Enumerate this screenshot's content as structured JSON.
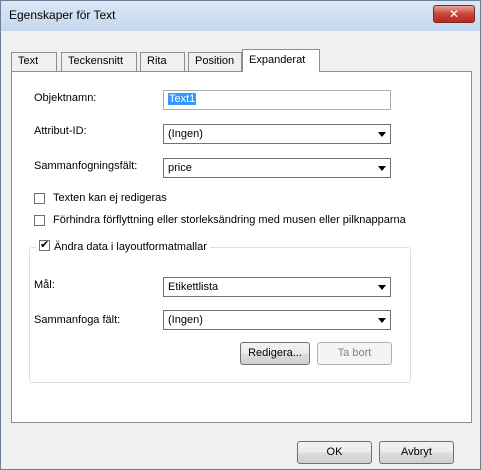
{
  "window": {
    "title": "Egenskaper för Text",
    "close_icon": "close-icon"
  },
  "tabs": [
    {
      "label": "Text"
    },
    {
      "label": "Teckensnitt"
    },
    {
      "label": "Rita"
    },
    {
      "label": "Position"
    },
    {
      "label": "Expanderat"
    }
  ],
  "active_tab": "Expanderat",
  "form": {
    "object_name_label": "Objektnamn:",
    "object_name_value": "Text1",
    "attribute_id_label": "Attribut-ID:",
    "attribute_id_value": "(Ingen)",
    "merge_field_label": "Sammanfogningsfält:",
    "merge_field_value": "price",
    "not_editable_label": "Texten kan ej redigeras",
    "not_editable_checked": false,
    "prevent_move_label": "Förhindra förflyttning eller storleksändring med musen eller pilknapparna",
    "prevent_move_checked": false
  },
  "group": {
    "legend": "Ändra data i layoutformatmallar",
    "legend_checked": true,
    "target_label": "Mål:",
    "target_value": "Etikettlista",
    "merge_field_label": "Sammanfoga fält:",
    "merge_field_value": "(Ingen)",
    "edit_button": "Redigera...",
    "remove_button": "Ta bort"
  },
  "footer": {
    "ok_button": "OK",
    "cancel_button": "Avbryt"
  }
}
